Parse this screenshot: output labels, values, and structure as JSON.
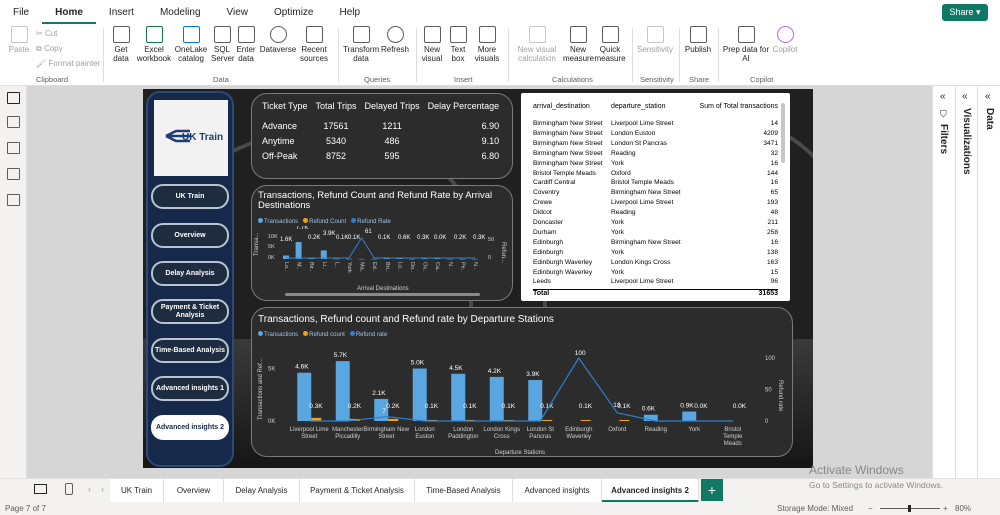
{
  "menu": [
    "File",
    "Home",
    "Insert",
    "Modeling",
    "View",
    "Optimize",
    "Help"
  ],
  "share_label": "Share",
  "ribbon": {
    "paste": "Paste",
    "cut": "Cut",
    "copy": "Copy",
    "format_painter": "Format painter",
    "get_data_1": "Get",
    "get_data_2": "data",
    "excel_1": "Excel",
    "excel_2": "workbook",
    "onelake_1": "OneLake",
    "onelake_2": "catalog",
    "sql_1": "SQL",
    "sql_2": "Server",
    "enter_1": "Enter",
    "enter_2": "data",
    "dataverse": "Dataverse",
    "recent_1": "Recent",
    "recent_2": "sources",
    "transform_1": "Transform",
    "transform_2": "data",
    "refresh": "Refresh",
    "new_visual_1": "New",
    "new_visual_2": "visual",
    "text_box_1": "Text",
    "text_box_2": "box",
    "more_visuals_1": "More",
    "more_visuals_2": "visuals",
    "new_visual_calc_1": "New visual",
    "new_visual_calc_2": "calculation",
    "new_measure_1": "New",
    "new_measure_2": "measure",
    "quick_measure_1": "Quick",
    "quick_measure_2": "measure",
    "sensitivity": "Sensitivity",
    "publish": "Publish",
    "prep_ai_1": "Prep data for",
    "prep_ai_2": "AI",
    "copilot": "Copilot",
    "groups": [
      "Clipboard",
      "Data",
      "Queries",
      "Insert",
      "Calculations",
      "Sensitivity",
      "Share",
      "Copilot"
    ]
  },
  "logo_text": "UK Train",
  "nav": [
    "UK Train",
    "Overview",
    "Delay Analysis",
    "Payment & Ticket Analysis",
    "Time-Based Analysis",
    "Advanced insights 1",
    "Advanced insights 2"
  ],
  "ticket_table": {
    "headers": [
      "Ticket Type",
      "Total Trips",
      "Delayed Trips",
      "Delay Percentage"
    ],
    "rows": [
      [
        "Advance",
        "17561",
        "1211",
        "6.90"
      ],
      [
        "Anytime",
        "5340",
        "486",
        "9.10"
      ],
      [
        "Off-Peak",
        "8752",
        "595",
        "6.80"
      ]
    ]
  },
  "arrival_chart": {
    "title": "Transactions, Refund Count and Refund Rate by Arrival Destinations",
    "legend": [
      "Transactions",
      "Refund Count",
      "Refund Rate"
    ],
    "xlabel": "Arrival Destinations",
    "ylabel": "Transa...",
    "y2label": "Refun...",
    "y_ticks": [
      "10K",
      "5K",
      "0K"
    ],
    "y2_ticks": [
      "50",
      "0"
    ],
    "data_labels": [
      "1.6K",
      "7.7K",
      "0.2K",
      "3.9K",
      "0.1K",
      "0.1K",
      "61",
      "0.1K",
      "0.6K",
      "0.3K",
      "0.0K",
      "0.2K",
      "0.3K"
    ],
    "x_ticks": [
      "Lo..",
      "M..",
      "Bir..",
      "Li..",
      "L..",
      "York",
      "Ma..",
      "Ed..",
      "Bri..",
      "Lo..",
      "Do..",
      "Ox..",
      "Ca..",
      "N..",
      "Pe..",
      "N.."
    ]
  },
  "pairs_table": {
    "headers": [
      "arrival_destination",
      "departure_station",
      "Sum of Total transactions"
    ],
    "rows": [
      [
        "Birmingham New Street",
        "Liverpool Lime Street",
        "14"
      ],
      [
        "Birmingham New Street",
        "London Euston",
        "4209"
      ],
      [
        "Birmingham New Street",
        "London St Pancras",
        "3471"
      ],
      [
        "Birmingham New Street",
        "Reading",
        "32"
      ],
      [
        "Birmingham New Street",
        "York",
        "16"
      ],
      [
        "Bristol Temple Meads",
        "Oxford",
        "144"
      ],
      [
        "Cardiff Central",
        "Bristol Temple Meads",
        "16"
      ],
      [
        "Coventry",
        "Birmingham New Street",
        "65"
      ],
      [
        "Crewe",
        "Liverpool Lime Street",
        "193"
      ],
      [
        "Didcot",
        "Reading",
        "48"
      ],
      [
        "Doncaster",
        "York",
        "211"
      ],
      [
        "Durham",
        "York",
        "258"
      ],
      [
        "Edinburgh",
        "Birmingham New Street",
        "16"
      ],
      [
        "Edinburgh",
        "York",
        "138"
      ],
      [
        "Edinburgh Waverley",
        "London Kings Cross",
        "163"
      ],
      [
        "Edinburgh Waverley",
        "York",
        "15"
      ],
      [
        "Leeds",
        "Liverpool Lime Street",
        "96"
      ]
    ],
    "total_label": "Total",
    "total_value": "31653"
  },
  "chart_data": {
    "type": "bar",
    "title": "Transactions, Refund count and Refund rate by Departure Stations",
    "xlabel": "Departure Stations",
    "ylabel": "Transactions and Ref...",
    "y2label": "Refund rate",
    "legend": [
      "Transactions",
      "Refund count",
      "Refund rate"
    ],
    "categories": [
      "Liverpool Lime Street",
      "Manchester Piccadilly",
      "Birmingham New Street",
      "London Euston",
      "London Paddington",
      "London Kings Cross",
      "London St Pancras",
      "Edinburgh Waverley",
      "Oxford",
      "Reading",
      "York",
      "Bristol Temple Meads"
    ],
    "series": [
      {
        "name": "Transactions",
        "values": [
          4600,
          5700,
          2100,
          5000,
          4500,
          4200,
          3900,
          0,
          0,
          600,
          900,
          0
        ],
        "labels": [
          "4.6K",
          "5.7K",
          "2.1K",
          "5.0K",
          "4.5K",
          "4.2K",
          "3.9K",
          "",
          "",
          "0.6K",
          "0.9K",
          ""
        ]
      },
      {
        "name": "Refund count",
        "values": [
          300,
          200,
          200,
          100,
          100,
          100,
          100,
          100,
          100,
          0,
          0,
          0
        ],
        "labels": [
          "0.3K",
          "0.2K",
          "0.2K",
          "0.1K",
          "0.1K",
          "0.1K",
          "0.1K",
          "0.1K",
          "0.1K",
          "",
          "0.0K",
          "0.0K"
        ]
      },
      {
        "name": "Refund rate",
        "values": [
          0,
          0,
          7,
          0,
          0,
          0,
          0,
          100,
          13,
          0,
          0,
          0
        ],
        "labels": [
          "",
          "",
          "7",
          "",
          "",
          "",
          "",
          "100",
          "13",
          "",
          "",
          ""
        ]
      }
    ],
    "ylim": [
      0,
      6000
    ],
    "y2lim": [
      0,
      100
    ],
    "y_ticks": [
      "5K",
      "0K"
    ],
    "y2_ticks": [
      "100",
      "50",
      "0"
    ],
    "colors": {
      "Transactions": "#5aa6e0",
      "Refund count": "#f2a20e",
      "Refund rate": "#2f7fd0"
    }
  },
  "panes": {
    "filters": "Filters",
    "visualizations": "Visualizations",
    "data": "Data"
  },
  "tabs": [
    "UK Train",
    "Overview",
    "Delay Analysis",
    "Payment & Ticket Analysis",
    "Time-Based Analysis",
    "Advanced insights",
    "Advanced insights 2"
  ],
  "activate": {
    "line1": "Activate Windows",
    "line2": "Go to Settings to activate Windows."
  },
  "status": {
    "page": "Page 7 of 7",
    "storage": "Storage Mode: Mixed",
    "zoom": "80%"
  }
}
